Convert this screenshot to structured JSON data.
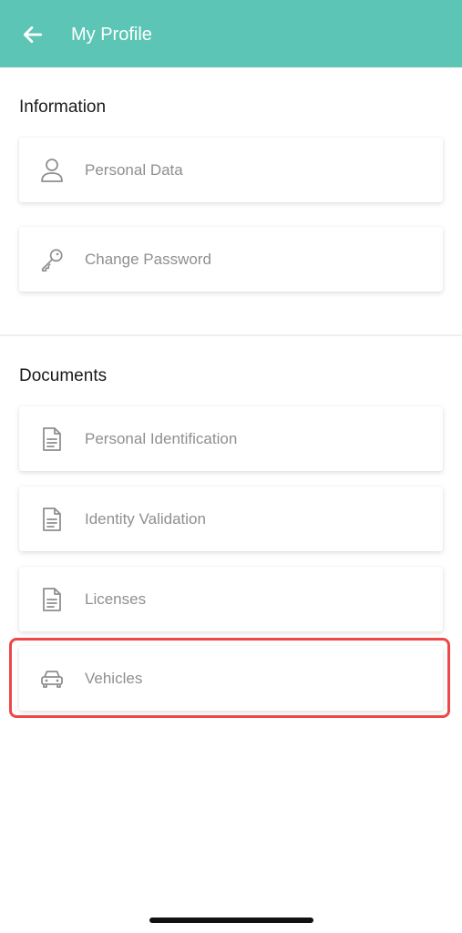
{
  "header": {
    "title": "My Profile",
    "back_icon": "arrow-left-icon"
  },
  "sections": {
    "information": {
      "title": "Information",
      "items": [
        {
          "label": "Personal Data",
          "icon": "person-icon"
        },
        {
          "label": "Change Password",
          "icon": "key-icon"
        }
      ]
    },
    "documents": {
      "title": "Documents",
      "items": [
        {
          "label": "Personal Identification",
          "icon": "document-icon"
        },
        {
          "label": "Identity Validation",
          "icon": "document-icon"
        },
        {
          "label": "Licenses",
          "icon": "document-icon"
        },
        {
          "label": "Vehicles",
          "icon": "car-icon"
        }
      ]
    }
  },
  "colors": {
    "appbar": "#5cc5b5",
    "highlight": "#ee4747",
    "label_text": "#8f8f8f"
  }
}
